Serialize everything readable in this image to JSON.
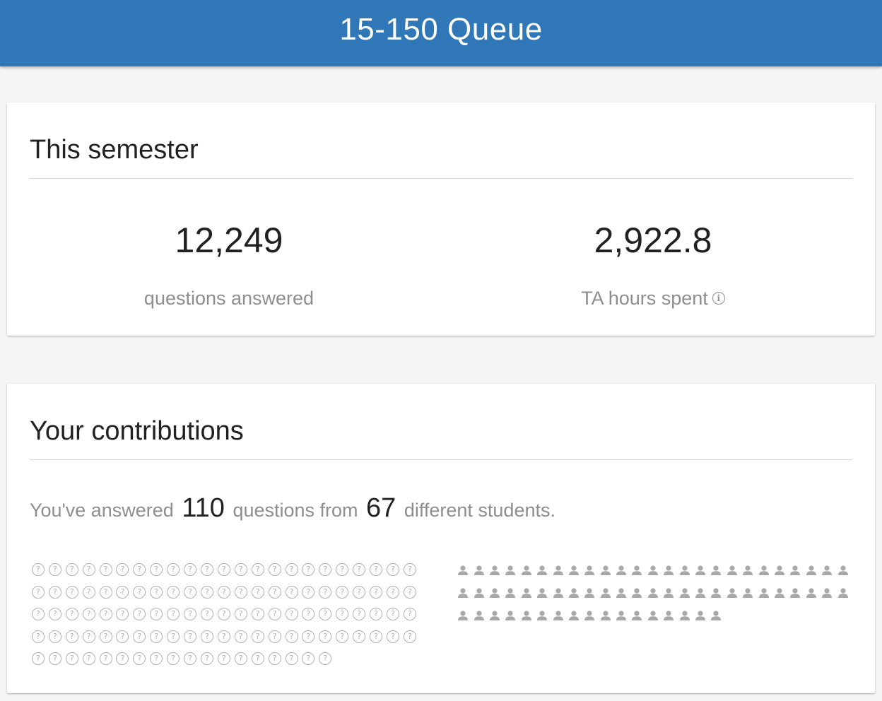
{
  "appbar": {
    "title": "15-150 Queue",
    "color": "#3077b8"
  },
  "semester": {
    "title": "This semester",
    "stats": {
      "questions": {
        "value": "12,249",
        "label": "questions answered"
      },
      "hours": {
        "value": "2,922.8",
        "label": "TA hours spent",
        "icon": "info-icon"
      }
    }
  },
  "contributions": {
    "title": "Your contributions",
    "summary": {
      "prefix": "You've answered",
      "questions": "110",
      "middle": "questions from",
      "students": "67",
      "suffix": "different students."
    },
    "question_icon_count": 110,
    "student_icon_count": 67,
    "question_icon": "help-circle-icon",
    "student_icon": "person-icon"
  }
}
